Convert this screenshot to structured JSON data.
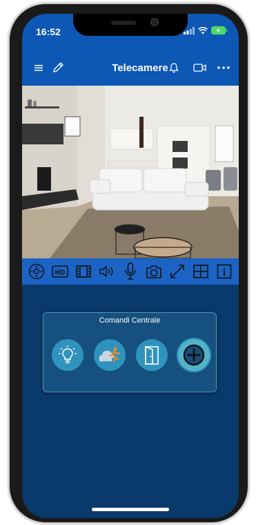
{
  "status_bar": {
    "time": "16:52",
    "signal_icon": "cellular-signal-icon",
    "wifi_icon": "wifi-icon",
    "battery_icon": "battery-charging-icon"
  },
  "nav": {
    "title": "Telecamere",
    "left_icons": [
      "menu-icon",
      "edit-pencil-icon"
    ],
    "right_icons": [
      "bell-icon",
      "video-camera-icon",
      "more-dots-icon"
    ]
  },
  "camera": {
    "feed": "living-room-camera-feed"
  },
  "toolbar": {
    "items": [
      {
        "name": "ptz-control",
        "icon": "ptz-arrows-icon"
      },
      {
        "name": "hd",
        "icon": "hd-icon",
        "label": "HD"
      },
      {
        "name": "record",
        "icon": "film-icon"
      },
      {
        "name": "audio",
        "icon": "speaker-icon"
      },
      {
        "name": "microphone",
        "icon": "microphone-icon"
      },
      {
        "name": "snapshot",
        "icon": "camera-icon"
      },
      {
        "name": "fullscreen",
        "icon": "expand-icon"
      },
      {
        "name": "grid",
        "icon": "grid-icon"
      },
      {
        "name": "info",
        "icon": "info-icon",
        "label": "i"
      }
    ]
  },
  "panel": {
    "title": "Comandi Centrale",
    "buttons": [
      {
        "name": "light",
        "icon": "lightbulb-icon"
      },
      {
        "name": "alarm-exit",
        "icon": "cloud-running-person-icon"
      },
      {
        "name": "door",
        "icon": "door-icon"
      },
      {
        "name": "add",
        "icon": "plus-circle-icon"
      }
    ]
  },
  "colors": {
    "nav_blue": "#0d57b5",
    "toolbar_blue": "#1b64c5",
    "content_bg": "#0a3a6b",
    "panel_bg": "#15507f",
    "button_teal": "#2f93bd"
  }
}
